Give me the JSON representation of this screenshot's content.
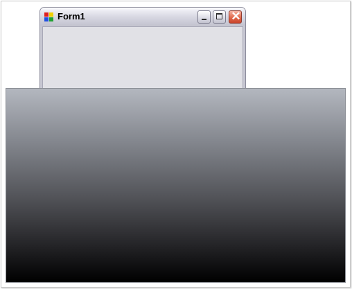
{
  "window": {
    "title": "Form1",
    "icon": "windows-form-icon",
    "buttons": {
      "minimize_icon": "minimize-icon",
      "maximize_icon": "maximize-icon",
      "close_icon": "close-icon",
      "close_glyph": "✕"
    }
  },
  "panel": {
    "gradient_top_color": "#b3b7bf",
    "gradient_bottom_color": "#000000"
  }
}
